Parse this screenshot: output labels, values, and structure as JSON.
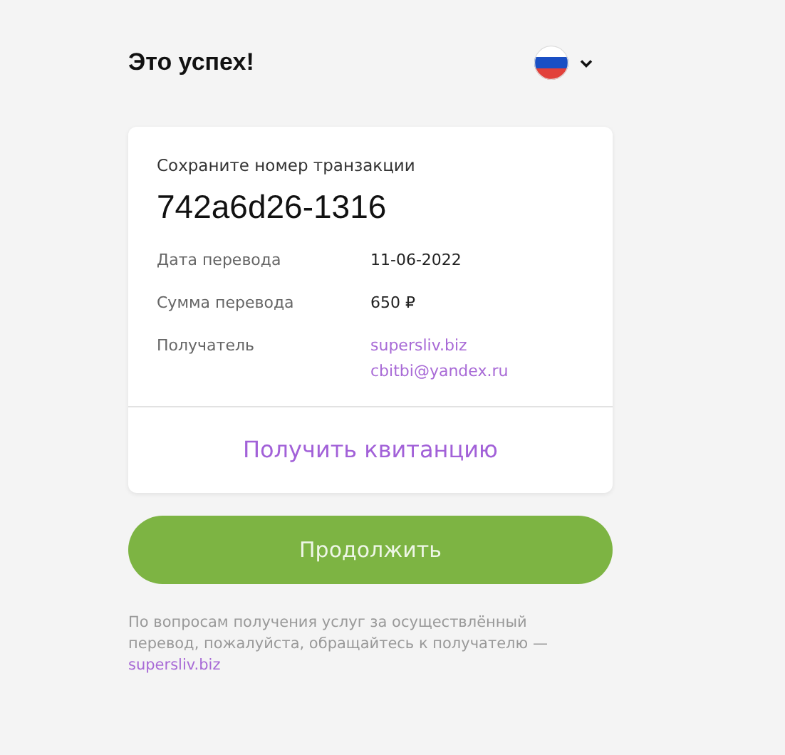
{
  "header": {
    "title": "Это успех!",
    "language": {
      "expanded": false
    }
  },
  "card": {
    "caption": "Сохраните номер транзакции",
    "transaction_id": "742a6d26-1316",
    "details": [
      {
        "label": "Дата перевода",
        "values": [
          {
            "text": "11-06-2022",
            "kind": "text"
          }
        ]
      },
      {
        "label": "Сумма перевода",
        "values": [
          {
            "text": "650 ₽",
            "kind": "text"
          }
        ]
      },
      {
        "label": "Получатель",
        "values": [
          {
            "text": "supersliv.biz",
            "kind": "link"
          },
          {
            "text": "cbitbi@yandex.ru",
            "kind": "link"
          }
        ]
      }
    ],
    "receipt_link": "Получить квитанцию"
  },
  "continue_button": "Продолжить",
  "footer": {
    "text": "По вопросам получения услуг за осуществлённый перевод, пожалуйста, обращайтесь к получателю —",
    "link": "supersliv.biz"
  }
}
